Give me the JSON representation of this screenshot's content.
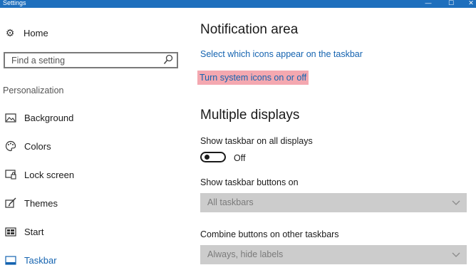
{
  "window": {
    "title": "Settings",
    "min_glyph": "—",
    "max_glyph": "☐",
    "close_glyph": "✕"
  },
  "sidebar": {
    "home_label": "Home",
    "search_placeholder": "Find a setting",
    "section_heading": "Personalization",
    "items": [
      {
        "label": "Background",
        "icon": "picture-icon"
      },
      {
        "label": "Colors",
        "icon": "palette-icon"
      },
      {
        "label": "Lock screen",
        "icon": "lock-screen-icon"
      },
      {
        "label": "Themes",
        "icon": "brush-icon"
      },
      {
        "label": "Start",
        "icon": "start-icon"
      },
      {
        "label": "Taskbar",
        "icon": "taskbar-icon",
        "selected": true
      }
    ]
  },
  "main": {
    "notification_heading": "Notification area",
    "select_icons_link": "Select which icons appear on the taskbar",
    "system_icons_link": "Turn system icons on or off",
    "multiple_displays_heading": "Multiple displays",
    "show_on_all_label": "Show taskbar on all displays",
    "show_on_all_state": "Off",
    "buttons_on_label": "Show taskbar buttons on",
    "buttons_on_value": "All taskbars",
    "combine_label": "Combine buttons on other taskbars",
    "combine_value": "Always, hide labels"
  },
  "colors": {
    "accent": "#1463b0",
    "titlebar": "#1e6fbd",
    "highlight": "#f4a8b0",
    "disabled_dropdown": "#cccccc"
  }
}
